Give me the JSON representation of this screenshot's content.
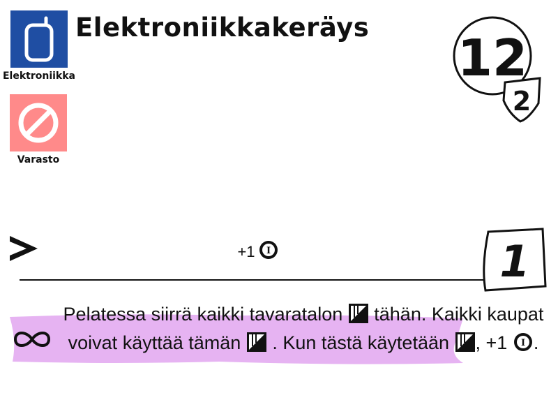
{
  "card": {
    "title": "Elektroniikkakeräys",
    "tags": [
      {
        "label": "Elektroniikka",
        "icon": "phone-icon",
        "color": "#1f4ea3"
      },
      {
        "label": "Varasto",
        "icon": "prohibited-icon",
        "color": "#ff8a8a"
      }
    ],
    "cost": {
      "value": "12",
      "secondary": "2"
    },
    "trigger_effect": {
      "text": "+1",
      "icon": "influence-token-icon"
    },
    "victory_points": "1",
    "ability": {
      "icon": "infinity-icon",
      "highlight_color": "#e6b3f2",
      "part1": "Pelatessa siirrä kaikki tavaratalon",
      "part2": "tähän. Kaikki kaupat voivat käyttää tämän",
      "part3": ". Kun tästä käytetään",
      "part4": ", +1",
      "part5": "."
    }
  }
}
